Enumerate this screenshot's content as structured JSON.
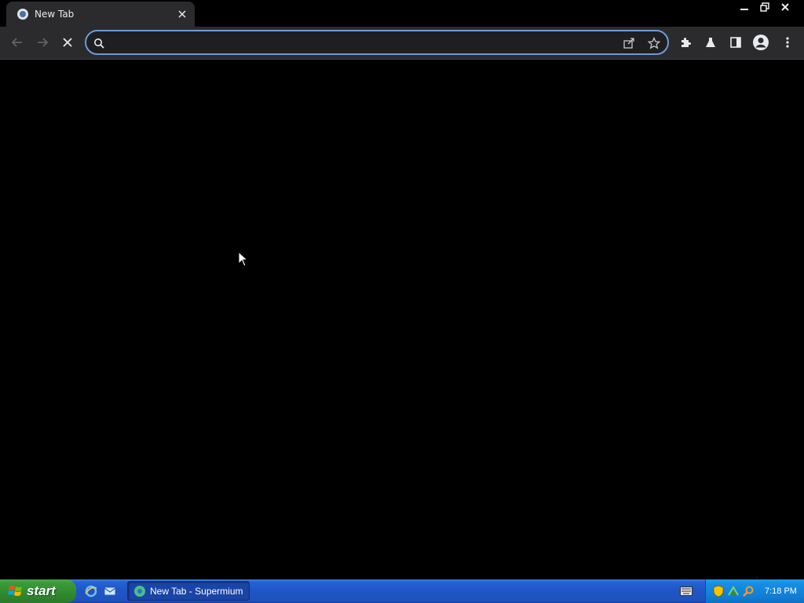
{
  "browser": {
    "tab": {
      "title": "New Tab",
      "favicon_icon": "chromium-favicon-icon",
      "close_icon": "close-icon"
    },
    "window_controls": [
      "minimize-icon",
      "restore-icon",
      "close-icon"
    ],
    "toolbar": {
      "back_icon": "arrow-left-icon",
      "forward_icon": "arrow-right-icon",
      "stop_icon": "stop-icon",
      "omnibox": {
        "value": "",
        "placeholder": "",
        "search_icon": "search-icon",
        "share_icon": "share-icon",
        "bookmark_icon": "star-icon"
      },
      "extensions_icon": "puzzle-icon",
      "labs_icon": "flask-icon",
      "side_panel_icon": "side-panel-icon",
      "profile_icon": "avatar-icon",
      "menu_icon": "kebab-menu-icon"
    }
  },
  "taskbar": {
    "start_label": "start",
    "quick_launch": [
      "internet-explorer-icon",
      "outlook-express-icon"
    ],
    "task_label": "New Tab - Supermium",
    "tray_time": "7:18 PM",
    "tray_icons": [
      "keyboard-icon",
      "security-shield-icon",
      "network-icon",
      "search-icon"
    ]
  },
  "colors": {
    "accent": "#6f9ad8",
    "taskbar_blue": "#1f55c4",
    "start_green": "#2f8a2f",
    "toolbar_bg": "#2b2b2e"
  }
}
